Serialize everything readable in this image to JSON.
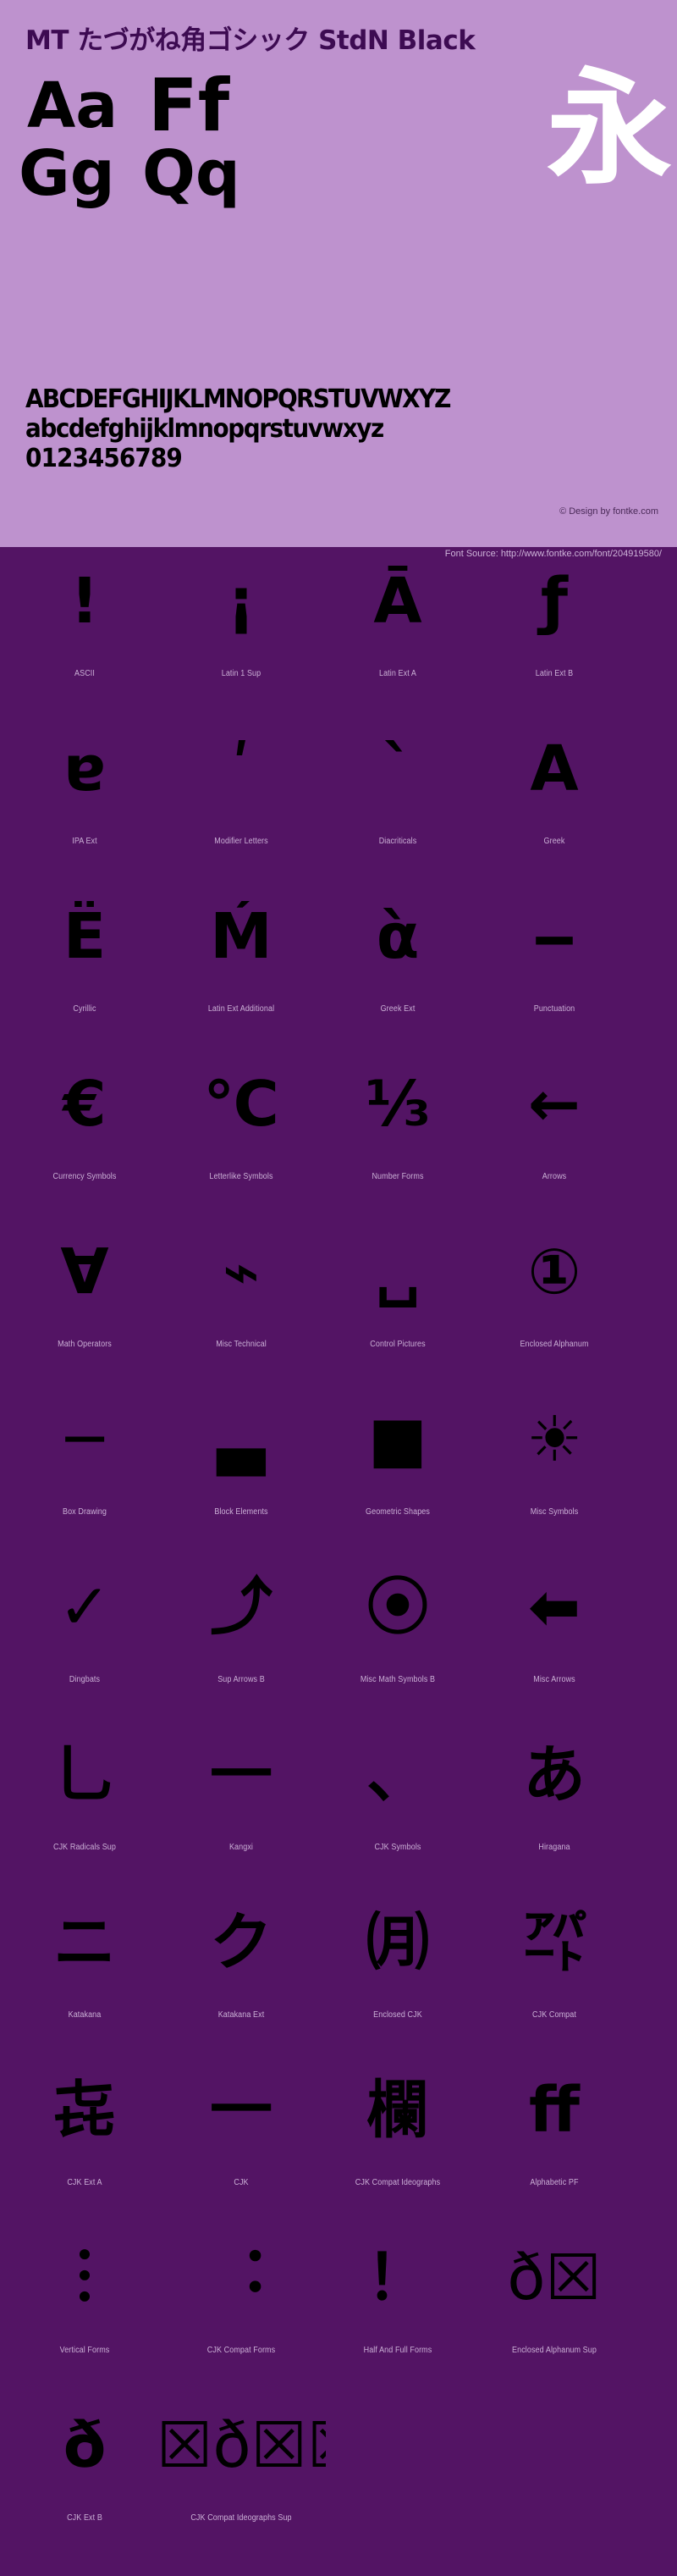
{
  "hero": {
    "title": "MT たづがね角ゴシック StdN Black",
    "samples": [
      {
        "name": "sample-aa",
        "text": "Aa"
      },
      {
        "name": "sample-ff",
        "text": "Ff"
      },
      {
        "name": "sample-gg",
        "text": "Gg"
      },
      {
        "name": "sample-qq",
        "text": "Qq"
      }
    ],
    "cjk_sample": "永",
    "alphabet": {
      "uppercase": "ABCDEFGHIJKLMNOPQRSTUVWXYZ",
      "lowercase": "abcdefghijklmnopqrstuvwxyz",
      "digits": "0123456789"
    },
    "credit": "© Design by fontke.com",
    "background_color": "#BE92CE",
    "title_color": "#3D0B52"
  },
  "source": {
    "text": "Font Source: http://www.fontke.com/font/204919580/",
    "background_color": "#531464",
    "text_color": "#CDB3D8"
  },
  "blocks": {
    "rows": [
      [
        {
          "label": "ASCII",
          "glyph": "!"
        },
        {
          "label": "Latin 1 Sup",
          "glyph": "¡"
        },
        {
          "label": "Latin Ext A",
          "glyph": "Ā"
        },
        {
          "label": "Latin Ext B",
          "glyph": "ƒ"
        }
      ],
      [
        {
          "label": "IPA Ext",
          "glyph": "ɐ"
        },
        {
          "label": "Modifier Letters",
          "glyph": "ʹ"
        },
        {
          "label": "Diacriticals",
          "glyph": "ˋ"
        },
        {
          "label": "Greek",
          "glyph": "Α"
        }
      ],
      [
        {
          "label": "Cyrillic",
          "glyph": "Ё"
        },
        {
          "label": "Latin Ext Additional",
          "glyph": "Ḿ"
        },
        {
          "label": "Greek Ext",
          "glyph": "ὰ"
        },
        {
          "label": "Punctuation",
          "glyph": "‒"
        }
      ],
      [
        {
          "label": "Currency Symbols",
          "glyph": "€"
        },
        {
          "label": "Letterlike Symbols",
          "glyph": "℃"
        },
        {
          "label": "Number Forms",
          "glyph": "⅓"
        },
        {
          "label": "Arrows",
          "glyph": "←"
        }
      ],
      [
        {
          "label": "Math Operators",
          "glyph": "∀"
        },
        {
          "label": "Misc Technical",
          "glyph": "⌁"
        },
        {
          "label": "Control Pictures",
          "glyph": "␣"
        },
        {
          "label": "Enclosed Alphanum",
          "glyph": "①"
        }
      ],
      [
        {
          "label": "Box Drawing",
          "glyph": "─"
        },
        {
          "label": "Block Elements",
          "glyph": "▃"
        },
        {
          "label": "Geometric Shapes",
          "glyph": "■"
        },
        {
          "label": "Misc Symbols",
          "glyph": "☀"
        }
      ],
      [
        {
          "label": "Dingbats",
          "glyph": "✓"
        },
        {
          "label": "Sup Arrows B",
          "glyph": "⤴"
        },
        {
          "label": "Misc Math Symbols B",
          "glyph": "⦿"
        },
        {
          "label": "Misc Arrows",
          "glyph": "⬅"
        }
      ],
      [
        {
          "label": "CJK Radicals Sup",
          "glyph": "⺃"
        },
        {
          "label": "Kangxi",
          "glyph": "⼀"
        },
        {
          "label": "CJK Symbols",
          "glyph": "、"
        },
        {
          "label": "Hiragana",
          "glyph": "あ"
        }
      ],
      [
        {
          "label": "Katakana",
          "glyph": "ニ"
        },
        {
          "label": "Katakana Ext",
          "glyph": "ク"
        },
        {
          "label": "Enclosed CJK",
          "glyph": "㈪"
        },
        {
          "label": "CJK Compat",
          "glyph": "㌀"
        }
      ],
      [
        {
          "label": "CJK Ext A",
          "glyph": "㐂"
        },
        {
          "label": "CJK",
          "glyph": "一"
        },
        {
          "label": "CJK Compat Ideographs",
          "glyph": "欄"
        },
        {
          "label": "Alphabetic PF",
          "glyph": "ﬀ"
        }
      ],
      [
        {
          "label": "Vertical Forms",
          "glyph": "︙"
        },
        {
          "label": "CJK Compat Forms",
          "glyph": "︓"
        },
        {
          "label": "Half And Full Forms",
          "glyph": "！"
        },
        {
          "label": "Enclosed Alphanum Sup",
          "glyph": "ð☒"
        }
      ],
      [
        {
          "label": "CJK Ext B",
          "glyph": "ð"
        },
        {
          "label": "CJK Compat Ideographs Sup",
          "glyph": "☒ð☒☒"
        },
        {
          "label": "",
          "glyph": ""
        },
        {
          "label": "",
          "glyph": ""
        }
      ]
    ]
  }
}
